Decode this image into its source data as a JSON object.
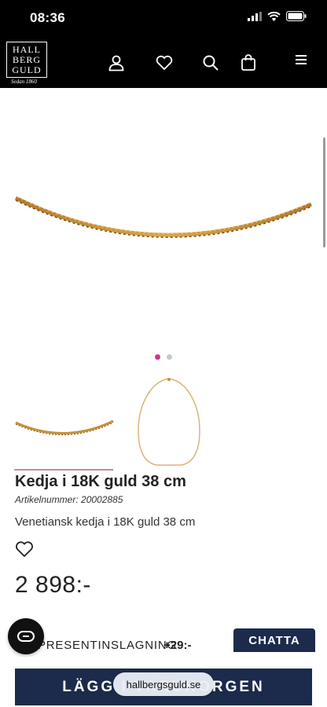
{
  "status_bar": {
    "time": "08:36"
  },
  "brand": {
    "logo_lines": [
      "HALL",
      "BERG",
      "GULD"
    ],
    "tagline": "Sedan 1860"
  },
  "header_icons": [
    "user-icon",
    "heart-icon",
    "search-icon",
    "bag-icon",
    "menu-icon"
  ],
  "gallery": {
    "image_count": 2,
    "active_index": 0
  },
  "product": {
    "title": "Kedja i 18K guld 38 cm",
    "article_number": "Artikelnummer: 20002885",
    "description": "Venetiansk kedja i 18K guld 38 cm",
    "price": "2 898:-"
  },
  "gift_wrap": {
    "label": "PRESENTINSLAGNING",
    "price": "+29:-"
  },
  "chat": {
    "button_label": "CHATTA"
  },
  "cart": {
    "button_label": "LÄGG I VARUKORGEN"
  },
  "browser": {
    "url": "hallbergsguld.se"
  },
  "colors": {
    "accent_pink": "#d6338f",
    "navy": "#1c2b4c",
    "gold": "#c8903a"
  }
}
